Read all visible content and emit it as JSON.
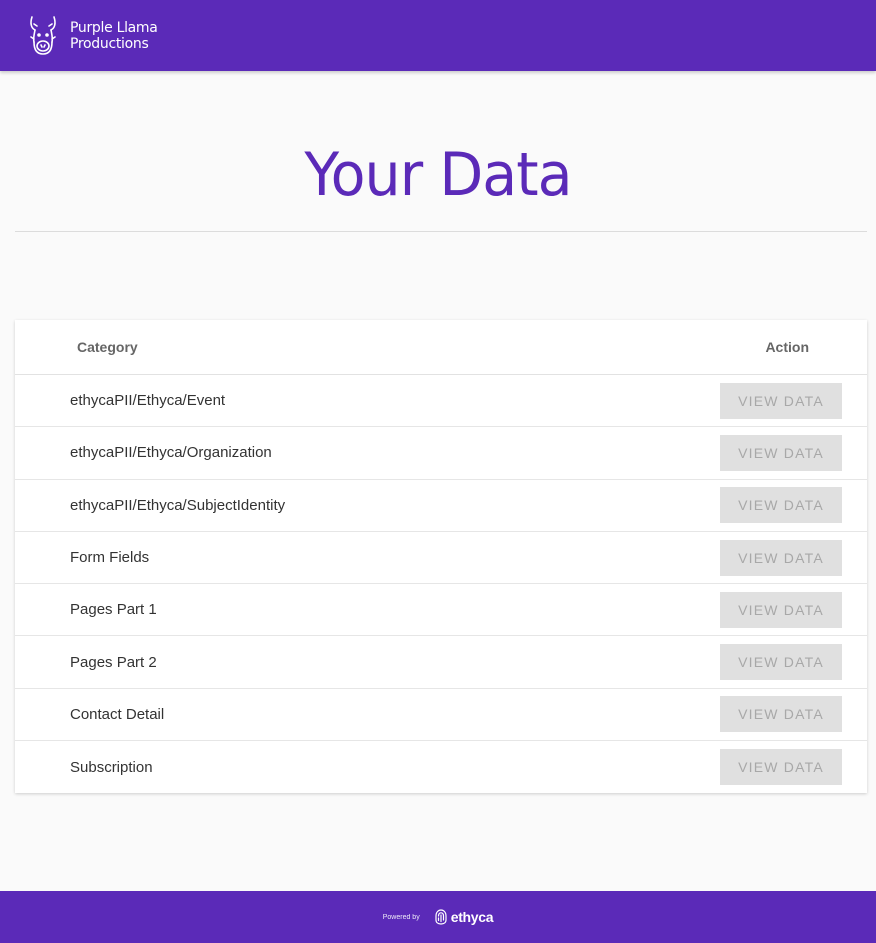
{
  "header": {
    "brand_line1": "Purple Llama",
    "brand_line2": "Productions",
    "logo_icon": "llama-icon"
  },
  "main": {
    "title": "Your Data"
  },
  "table": {
    "columns": {
      "category": "Category",
      "action": "Action"
    },
    "rows": [
      {
        "category": "ethycaPII/Ethyca/Event",
        "action_label": "VIEW DATA"
      },
      {
        "category": "ethycaPII/Ethyca/Organization",
        "action_label": "VIEW DATA"
      },
      {
        "category": "ethycaPII/Ethyca/SubjectIdentity",
        "action_label": "VIEW DATA"
      },
      {
        "category": "Form Fields",
        "action_label": "VIEW DATA"
      },
      {
        "category": "Pages Part 1",
        "action_label": "VIEW DATA"
      },
      {
        "category": "Pages Part 2",
        "action_label": "VIEW DATA"
      },
      {
        "category": "Contact Detail",
        "action_label": "VIEW DATA"
      },
      {
        "category": "Subscription",
        "action_label": "VIEW DATA"
      }
    ]
  },
  "footer": {
    "powered_by": "Powered by",
    "brand": "ethyca",
    "brand_icon": "ethyca-fingerprint-icon"
  },
  "colors": {
    "primary": "#5b2ab8",
    "button_bg": "#e0e0e0",
    "button_text": "#a8a8a8"
  }
}
